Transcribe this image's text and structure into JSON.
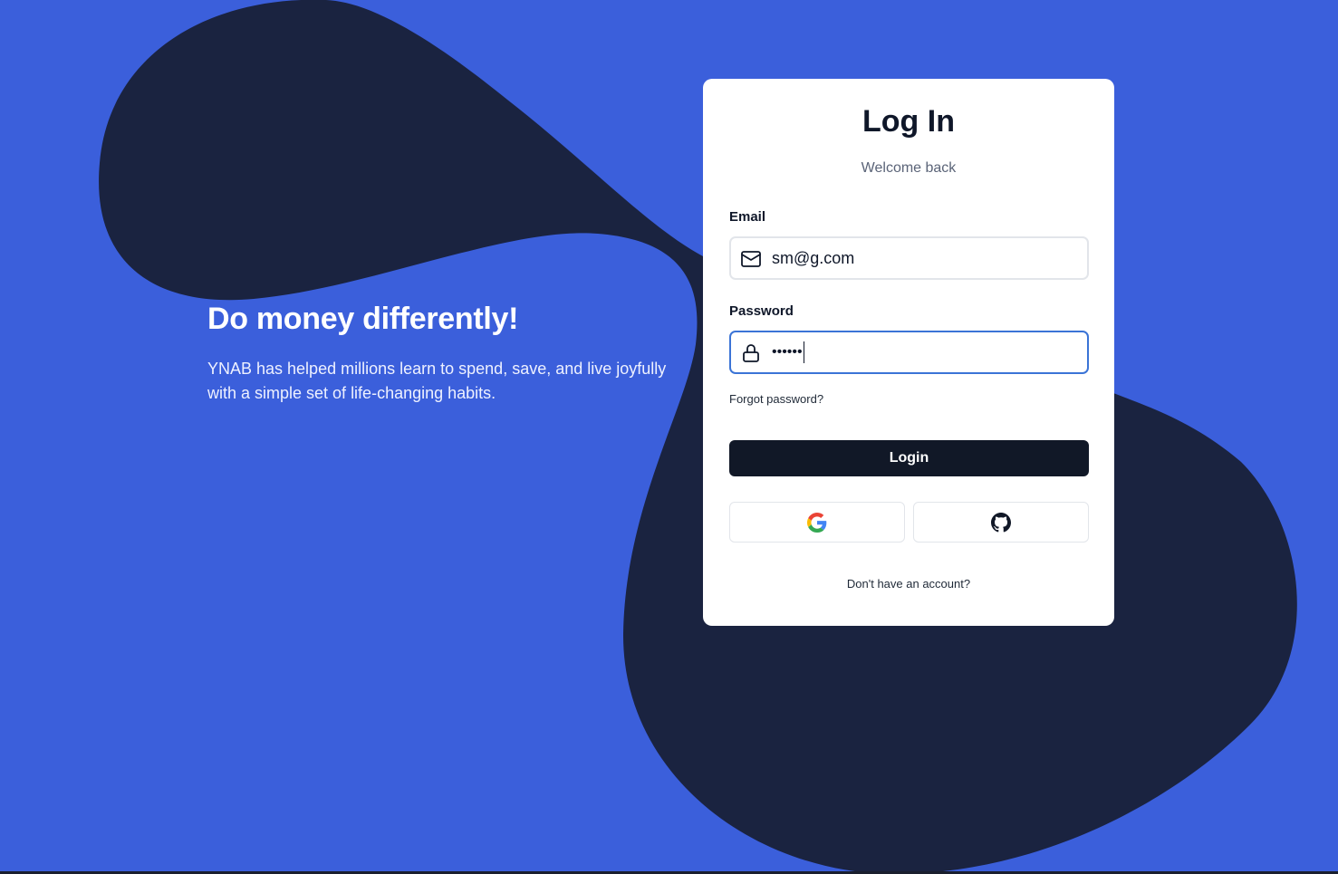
{
  "colors": {
    "background": "#3b5fdb",
    "blob": "#1a2340",
    "card": "#ffffff",
    "primary_button": "#111827",
    "focus_border": "#3b74d6"
  },
  "hero": {
    "title": "Do money differently!",
    "description": "YNAB has helped millions learn to spend, save, and live joyfully with a simple set of life-changing habits."
  },
  "login": {
    "title": "Log In",
    "subtitle": "Welcome back",
    "email": {
      "label": "Email",
      "value": "sm@g.com",
      "icon": "mail-icon"
    },
    "password": {
      "label": "Password",
      "value": "••••••",
      "icon": "lock-icon"
    },
    "forgot_label": "Forgot password?",
    "submit_label": "Login",
    "oauth": [
      {
        "provider": "Google",
        "icon": "google-icon"
      },
      {
        "provider": "GitHub",
        "icon": "github-icon"
      }
    ],
    "signup_label": "Don't have an account?"
  }
}
